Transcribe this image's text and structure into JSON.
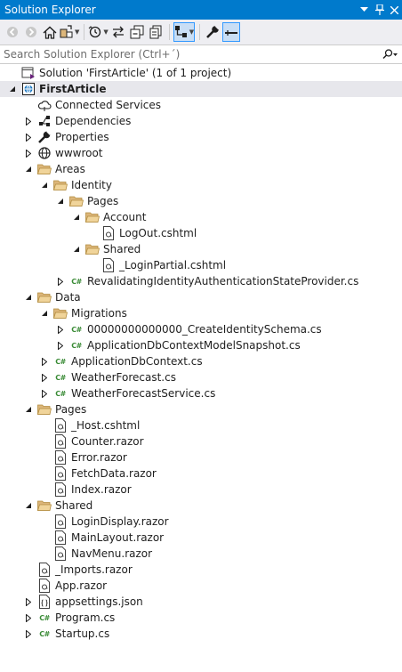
{
  "window": {
    "title": "Solution Explorer"
  },
  "search": {
    "placeholder": "Search Solution Explorer (Ctrl+´)"
  },
  "tree": [
    {
      "label": "Solution 'FirstArticle' (1 of 1 project)",
      "level": 0,
      "expander": "none",
      "icon": "solution-icon"
    },
    {
      "label": "FirstArticle",
      "level": 0,
      "expander": "expanded",
      "icon": "web-project-icon",
      "bold": true
    },
    {
      "label": "Connected Services",
      "level": 1,
      "expander": "none",
      "icon": "cloud-icon"
    },
    {
      "label": "Dependencies",
      "level": 1,
      "expander": "collapsed",
      "icon": "dependencies-icon"
    },
    {
      "label": "Properties",
      "level": 1,
      "expander": "collapsed",
      "icon": "wrench-icon"
    },
    {
      "label": "wwwroot",
      "level": 1,
      "expander": "collapsed",
      "icon": "globe-icon"
    },
    {
      "label": "Areas",
      "level": 1,
      "expander": "expanded",
      "icon": "folder-open-icon"
    },
    {
      "label": "Identity",
      "level": 2,
      "expander": "expanded",
      "icon": "folder-open-icon"
    },
    {
      "label": "Pages",
      "level": 3,
      "expander": "expanded",
      "icon": "folder-open-icon"
    },
    {
      "label": "Account",
      "level": 4,
      "expander": "expanded",
      "icon": "folder-open-icon"
    },
    {
      "label": "LogOut.cshtml",
      "level": 5,
      "expander": "none",
      "icon": "razor-file-icon"
    },
    {
      "label": "Shared",
      "level": 4,
      "expander": "expanded",
      "icon": "folder-open-icon"
    },
    {
      "label": "_LoginPartial.cshtml",
      "level": 5,
      "expander": "none",
      "icon": "razor-file-icon"
    },
    {
      "label": "RevalidatingIdentityAuthenticationStateProvider.cs",
      "level": 3,
      "expander": "collapsed",
      "icon": "csharp-file-icon"
    },
    {
      "label": "Data",
      "level": 1,
      "expander": "expanded",
      "icon": "folder-open-icon"
    },
    {
      "label": "Migrations",
      "level": 2,
      "expander": "expanded",
      "icon": "folder-open-icon"
    },
    {
      "label": "00000000000000_CreateIdentitySchema.cs",
      "level": 3,
      "expander": "collapsed",
      "icon": "csharp-file-icon"
    },
    {
      "label": "ApplicationDbContextModelSnapshot.cs",
      "level": 3,
      "expander": "collapsed",
      "icon": "csharp-file-icon"
    },
    {
      "label": "ApplicationDbContext.cs",
      "level": 2,
      "expander": "collapsed",
      "icon": "csharp-file-icon"
    },
    {
      "label": "WeatherForecast.cs",
      "level": 2,
      "expander": "collapsed",
      "icon": "csharp-file-icon"
    },
    {
      "label": "WeatherForecastService.cs",
      "level": 2,
      "expander": "collapsed",
      "icon": "csharp-file-icon"
    },
    {
      "label": "Pages",
      "level": 1,
      "expander": "expanded",
      "icon": "folder-open-icon"
    },
    {
      "label": "_Host.cshtml",
      "level": 2,
      "expander": "none",
      "icon": "razor-file-icon"
    },
    {
      "label": "Counter.razor",
      "level": 2,
      "expander": "none",
      "icon": "razor-file-icon"
    },
    {
      "label": "Error.razor",
      "level": 2,
      "expander": "none",
      "icon": "razor-file-icon"
    },
    {
      "label": "FetchData.razor",
      "level": 2,
      "expander": "none",
      "icon": "razor-file-icon"
    },
    {
      "label": "Index.razor",
      "level": 2,
      "expander": "none",
      "icon": "razor-file-icon"
    },
    {
      "label": "Shared",
      "level": 1,
      "expander": "expanded",
      "icon": "folder-open-icon"
    },
    {
      "label": "LoginDisplay.razor",
      "level": 2,
      "expander": "none",
      "icon": "razor-file-icon"
    },
    {
      "label": "MainLayout.razor",
      "level": 2,
      "expander": "none",
      "icon": "razor-file-icon"
    },
    {
      "label": "NavMenu.razor",
      "level": 2,
      "expander": "none",
      "icon": "razor-file-icon"
    },
    {
      "label": "_Imports.razor",
      "level": 1,
      "expander": "none",
      "icon": "razor-file-icon"
    },
    {
      "label": "App.razor",
      "level": 1,
      "expander": "none",
      "icon": "razor-file-icon"
    },
    {
      "label": "appsettings.json",
      "level": 1,
      "expander": "collapsed",
      "icon": "json-file-icon"
    },
    {
      "label": "Program.cs",
      "level": 1,
      "expander": "collapsed",
      "icon": "csharp-file-icon"
    },
    {
      "label": "Startup.cs",
      "level": 1,
      "expander": "collapsed",
      "icon": "csharp-file-icon"
    }
  ],
  "colors": {
    "titlebar": "#007acc",
    "toolbar": "#eeeef2",
    "selection": "#cce8ff",
    "folder": "#dcb67a",
    "csharp": "#388a34"
  }
}
